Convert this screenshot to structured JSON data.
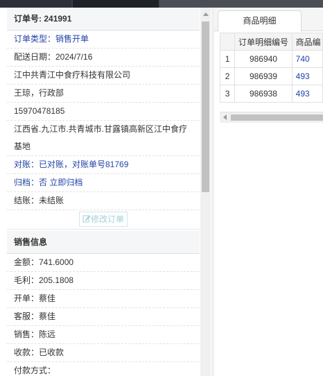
{
  "order": {
    "header_label": "订单号:",
    "header_value": "241991",
    "rows": [
      "订单类型：销售开单",
      "配送日期：2024/7/16",
      "江中共青江中食疗科技有限公司",
      "王琼，行政部",
      "15970478185",
      "江西省.九江市.共青城市.甘露镇高新区江中食疗",
      "基地",
      "对账：已对账，对账单号81769",
      "归档：否 立即归档",
      "结账：未结账"
    ],
    "edit_button": "修改订单",
    "edit_icon": "edit-icon"
  },
  "sales": {
    "title": "销售信息",
    "rows": [
      "金额：741.6000",
      "毛利：205.1808",
      "开单：蔡佳",
      "客服：蔡佳",
      "销售：陈远",
      "收款：已收款",
      "付款方式："
    ]
  },
  "detail": {
    "tab_label": "商品明细",
    "columns": [
      "",
      "订单明细编号",
      "商品编"
    ],
    "rows": [
      [
        "1",
        "986940",
        "740"
      ],
      [
        "2",
        "986939",
        "493"
      ],
      [
        "3",
        "986938",
        "493"
      ]
    ]
  },
  "colors": {
    "link_blue": "#2143a8",
    "topbar": "#3a3f47"
  }
}
